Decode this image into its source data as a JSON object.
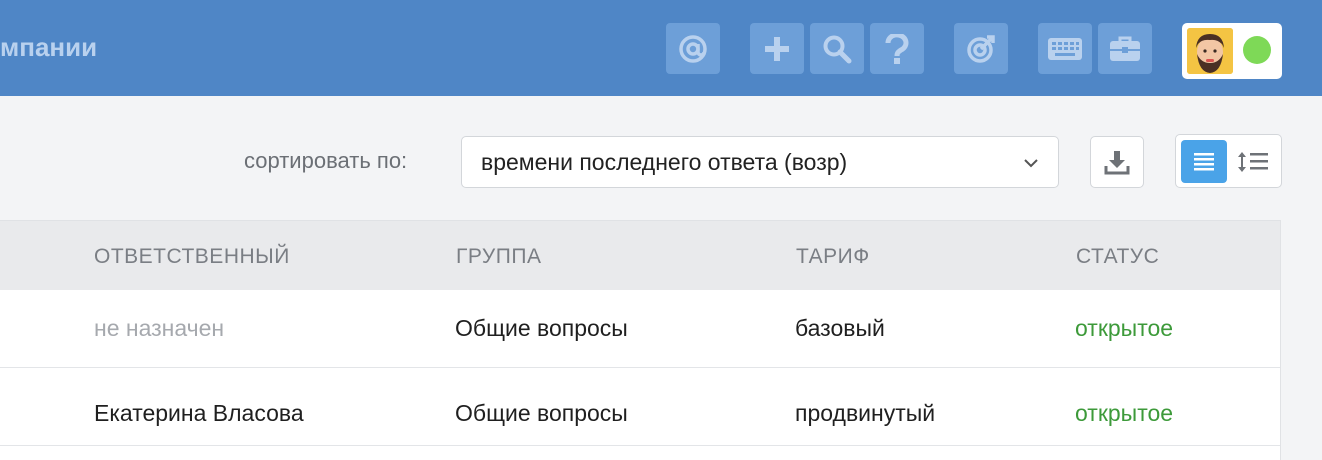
{
  "topbar": {
    "title": "мпании",
    "buttons": [
      {
        "icon": "at-icon"
      },
      {
        "icon": "plus-icon"
      },
      {
        "icon": "search-icon"
      },
      {
        "icon": "help-icon"
      },
      {
        "icon": "target-icon"
      },
      {
        "icon": "keyboard-icon"
      },
      {
        "icon": "briefcase-icon"
      }
    ],
    "status_color": "#7ed957",
    "accent": "#4f86c6"
  },
  "toolbar": {
    "sort_label": "сортировать по:",
    "sort_value": "времени последнего ответа (возр)"
  },
  "table": {
    "columns": [
      "ОТВЕТСТВЕННЫЙ",
      "ГРУППА",
      "ТАРИФ",
      "СТАТУС"
    ],
    "rows": [
      {
        "assignee": "не назначен",
        "group": "Общие вопросы",
        "tariff": "базовый",
        "status": "открытое"
      },
      {
        "assignee": "Екатерина Власова",
        "group": "Общие вопросы",
        "tariff": "продвинутый",
        "status": "открытое"
      }
    ]
  }
}
